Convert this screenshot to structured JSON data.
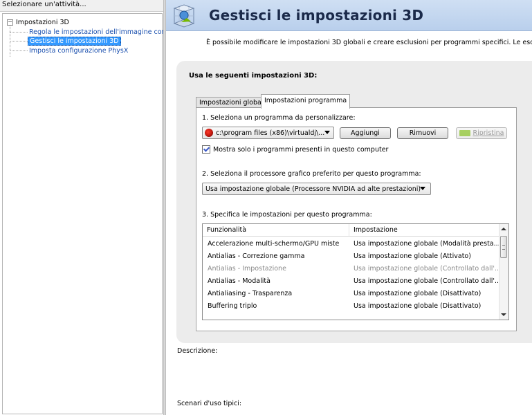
{
  "left_panel": {
    "header": "Selezionare un'attività...",
    "tree": {
      "root_label": "Impostazioni 3D",
      "root_expander": "−",
      "items": [
        {
          "label": "Regola le impostazioni dell'immagine con an"
        },
        {
          "label": "Gestisci le impostazioni 3D",
          "selected": true
        },
        {
          "label": "Imposta configurazione PhysX"
        }
      ]
    }
  },
  "header": {
    "title": "Gestisci le impostazioni 3D",
    "icon": "3d-settings-icon"
  },
  "intro_text": "È possibile modificare le impostazioni 3D globali e creare esclusioni per programmi specifici. Le esclusioni ver",
  "settings": {
    "heading": "Usa le seguenti impostazioni 3D:",
    "tabs": [
      {
        "label": "Impostazioni globali",
        "active": false
      },
      {
        "label": "Impostazioni programma",
        "active": true
      }
    ],
    "step1": {
      "label": "1. Seleziona un programma da personalizzare:",
      "program_value": "c:\\program files (x86)\\virtualdj\\...",
      "add_button": "Aggiungi",
      "remove_button": "Rimuovi",
      "restore_button": "Ripristina",
      "checkbox_label": "Mostra solo i programmi presenti in questo computer",
      "checkbox_checked": true
    },
    "step2": {
      "label": "2. Seleziona il processore grafico preferito per questo programma:",
      "gpu_value": "Usa impostazione globale (Processore NVIDIA ad alte prestazioni)"
    },
    "step3": {
      "label": "3. Specifica le impostazioni per questo programma:",
      "columns": [
        "Funzionalità",
        "Impostazione"
      ],
      "rows": [
        {
          "feature": "Accelerazione multi-schermo/GPU miste",
          "setting": "Usa impostazione globale (Modalità presta...",
          "dim": false
        },
        {
          "feature": "Antialias - Correzione gamma",
          "setting": "Usa impostazione globale (Attivato)",
          "dim": false
        },
        {
          "feature": "Antialias - Impostazione",
          "setting": "Usa impostazione globale (Controllato dall'...",
          "dim": true
        },
        {
          "feature": "Antialias - Modalità",
          "setting": "Usa impostazione globale (Controllato dall'...",
          "dim": false
        },
        {
          "feature": "Antialiasing - Trasparenza",
          "setting": "Usa impostazione globale (Disattivato)",
          "dim": false
        },
        {
          "feature": "Buffering triplo",
          "setting": "Usa impostazione globale (Disattivato)",
          "dim": false
        }
      ]
    }
  },
  "description_label": "Descrizione:",
  "usage_label": "Scenari d'uso tipici:"
}
